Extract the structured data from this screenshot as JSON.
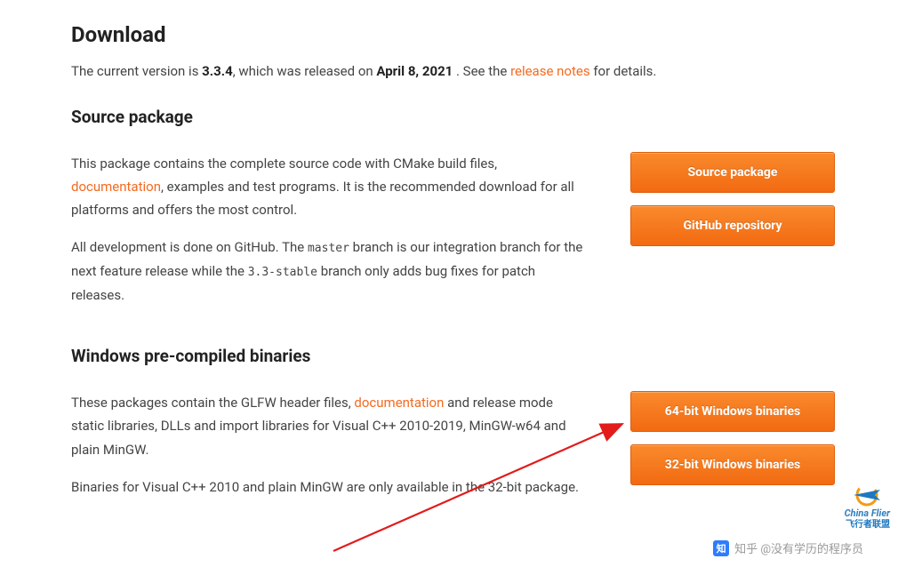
{
  "headings": {
    "download": "Download",
    "source_package": "Source package",
    "windows_binaries": "Windows pre-compiled binaries"
  },
  "intro": {
    "prefix": "The current version is ",
    "version": "3.3.4",
    "mid": ", which was released on ",
    "release_date": "April 8, 2021",
    "after_date": " . See the ",
    "release_notes_link": "release notes",
    "suffix": " for details."
  },
  "source": {
    "p1": {
      "t1": "This package contains the complete source code with CMake build files, ",
      "doc_link": "documentation",
      "t2": ", examples and test programs. It is the recommended download for all platforms and offers the most control."
    },
    "p2": {
      "t1": "All development is done on GitHub. The ",
      "code1": "master",
      "t2": " branch is our integration branch for the next feature release while the ",
      "code2": "3.3-stable",
      "t3": " branch only adds bug fixes for patch releases."
    }
  },
  "windows": {
    "p1": {
      "t1": "These packages contain the GLFW header files, ",
      "doc_link": "documentation",
      "t2": " and release mode static libraries, DLLs and import libraries for Visual C++ 2010-2019, MinGW-w64 and plain MinGW."
    },
    "p2": "Binaries for Visual C++ 2010 and plain MinGW are only available in the 32-bit package."
  },
  "buttons": {
    "source_package": "Source package",
    "github_repo": "GitHub repository",
    "win64": "64-bit Windows binaries",
    "win32": "32-bit Windows binaries"
  },
  "watermark": {
    "zhihu_label": "知",
    "zhihu_text": "知乎 @没有学历的程序员",
    "right_brand": "China Flier",
    "right_sub": "飞行者联盟"
  }
}
